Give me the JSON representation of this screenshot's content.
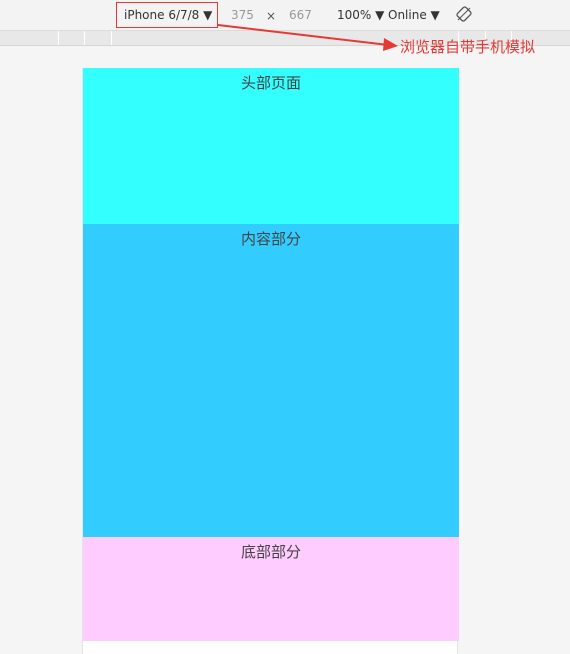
{
  "devtools_toolbar": {
    "device_select": "iPhone 6/7/8 ▼",
    "width": "375",
    "times_sign": "×",
    "height": "667",
    "zoom_select": "100% ▼",
    "network_select": "Online ▼",
    "rotate_icon": "rotate-icon"
  },
  "annotation": {
    "text": "浏览器自带手机模拟",
    "color": "#e53935"
  },
  "mobile_page": {
    "header_label": "头部页面",
    "content_label": "内容部分",
    "footer_label": "底部部分",
    "colors": {
      "header": "#33ffff",
      "content": "#33ccff",
      "footer": "#ffccff"
    }
  }
}
